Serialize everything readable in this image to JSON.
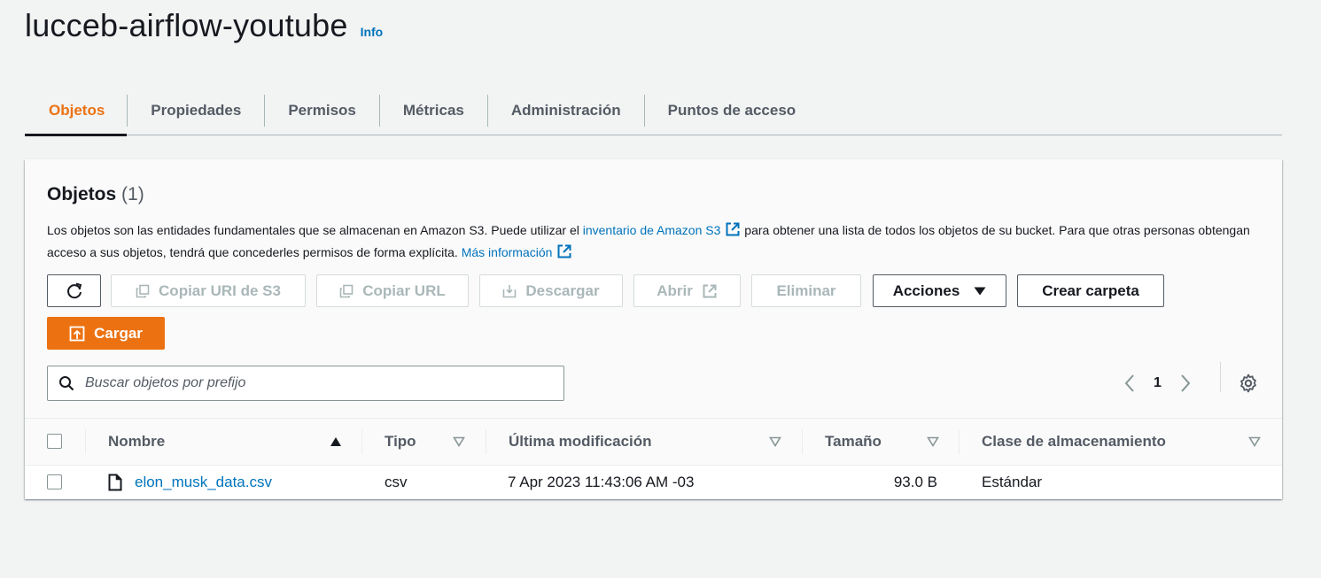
{
  "header": {
    "title": "lucceb-airflow-youtube",
    "info_link": "Info"
  },
  "tabs": [
    {
      "label": "Objetos",
      "active": true
    },
    {
      "label": "Propiedades"
    },
    {
      "label": "Permisos"
    },
    {
      "label": "Métricas"
    },
    {
      "label": "Administración"
    },
    {
      "label": "Puntos de acceso"
    }
  ],
  "panel": {
    "title": "Objetos",
    "count": "(1)",
    "description": {
      "part1": "Los objetos son las entidades fundamentales que se almacenan en Amazon S3. Puede utilizar el ",
      "link1": "inventario de Amazon S3",
      "part2": " para obtener una lista de todos los objetos de su bucket. Para que otras personas obtengan acceso a sus objetos, tendrá que concederles permisos de forma explícita. ",
      "link2": "Más información"
    }
  },
  "toolbar": {
    "copy_uri": "Copiar URI de S3",
    "copy_url": "Copiar URL",
    "download": "Descargar",
    "open": "Abrir",
    "delete": "Eliminar",
    "actions": "Acciones",
    "create_folder": "Crear carpeta",
    "upload": "Cargar"
  },
  "search": {
    "placeholder": "Buscar objetos por prefijo"
  },
  "pagination": {
    "current_page": "1"
  },
  "table": {
    "columns": [
      "Nombre",
      "Tipo",
      "Última modificación",
      "Tamaño",
      "Clase de almacenamiento"
    ],
    "rows": [
      {
        "name": "elon_musk_data.csv",
        "type": "csv",
        "modified": "7 Apr 2023 11:43:06 AM -03",
        "size": "93.0 B",
        "storage_class": "Estándar"
      }
    ]
  },
  "colors": {
    "accent": "#ec7211",
    "link": "#0073bb",
    "text": "#16191f",
    "muted": "#545b64"
  }
}
